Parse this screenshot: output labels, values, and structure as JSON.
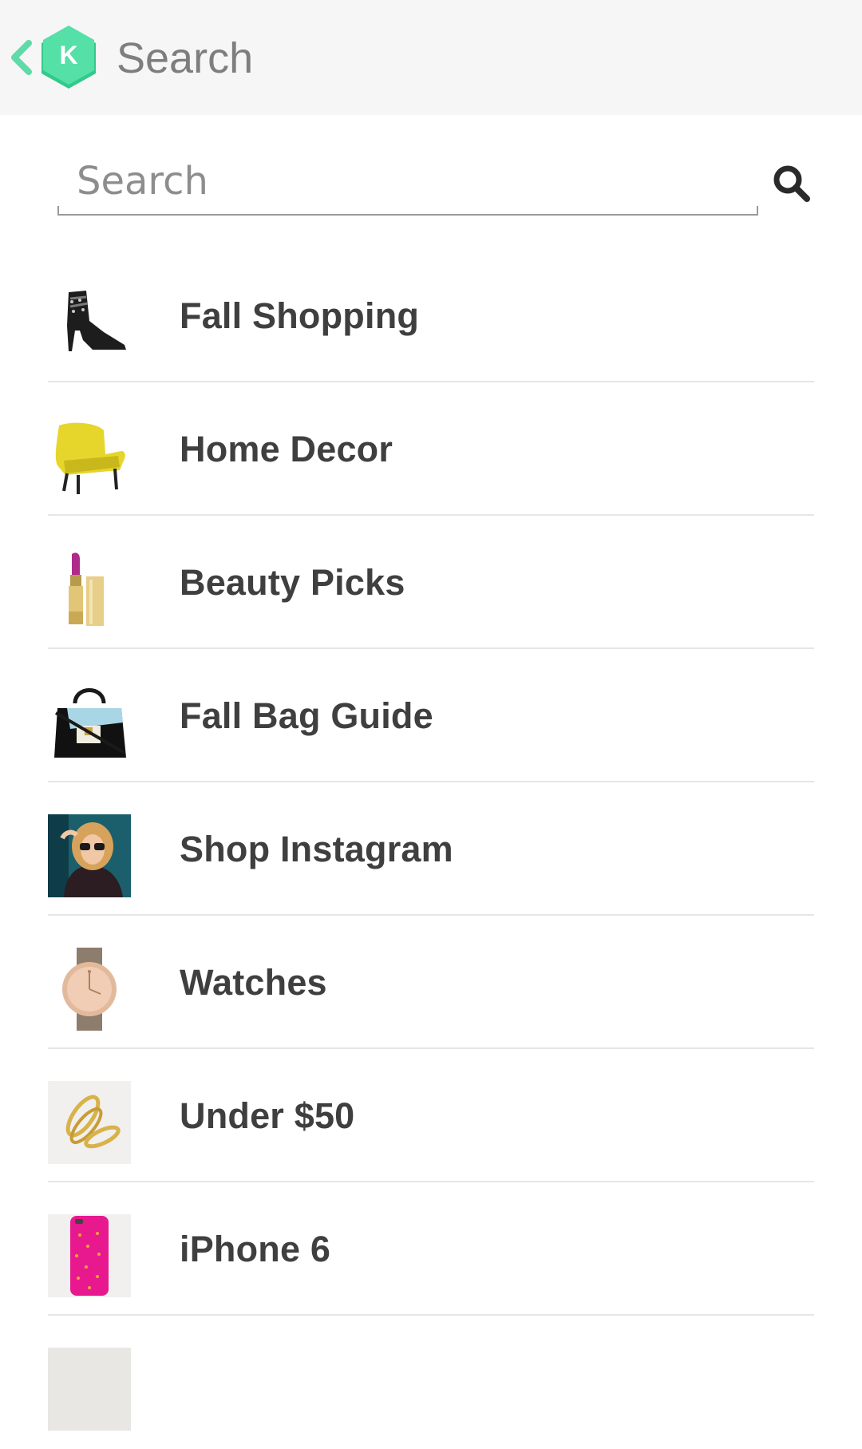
{
  "header": {
    "title": "Search",
    "logo_letter": "K",
    "brand_color": "#4cd9a2"
  },
  "search": {
    "placeholder": "Search",
    "value": ""
  },
  "categories": [
    {
      "label": "Fall Shopping",
      "icon": "ankle-boot-icon"
    },
    {
      "label": "Home Decor",
      "icon": "yellow-armchair-icon"
    },
    {
      "label": "Beauty Picks",
      "icon": "lipstick-icon"
    },
    {
      "label": "Fall Bag Guide",
      "icon": "handbag-icon"
    },
    {
      "label": "Shop Instagram",
      "icon": "instagram-photo-icon"
    },
    {
      "label": "Watches",
      "icon": "watch-icon"
    },
    {
      "label": "Under $50",
      "icon": "gold-rings-icon"
    },
    {
      "label": "iPhone 6",
      "icon": "phone-case-icon"
    }
  ]
}
